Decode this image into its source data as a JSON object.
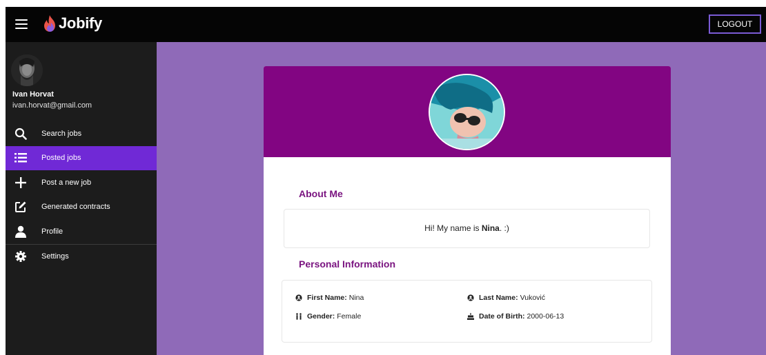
{
  "app": {
    "name": "Jobify"
  },
  "header": {
    "logout_label": "LOGOUT"
  },
  "user": {
    "name": "Ivan Horvat",
    "email": "ivan.horvat@gmail.com"
  },
  "sidebar": {
    "items": [
      {
        "label": "Search jobs",
        "icon": "search-icon"
      },
      {
        "label": "Posted jobs",
        "icon": "list-icon",
        "active": true
      },
      {
        "label": "Post a new job",
        "icon": "plus-icon"
      },
      {
        "label": "Generated contracts",
        "icon": "edit-icon"
      },
      {
        "label": "Profile",
        "icon": "person-icon"
      },
      {
        "label": "Settings",
        "icon": "gear-icon"
      }
    ]
  },
  "profile": {
    "about_title": "About Me",
    "about_prefix": "Hi! My name is ",
    "about_name": "Nina",
    "about_suffix": ". :)",
    "personal_title": "Personal Information",
    "first_name_label": "First Name:",
    "first_name": "Nina",
    "last_name_label": "Last Name:",
    "last_name": "Vuković",
    "gender_label": "Gender:",
    "gender": "Female",
    "dob_label": "Date of Birth:",
    "dob": "2000-06-13"
  },
  "colors": {
    "topbar": "#050505",
    "sidebar": "#1c1c1c",
    "active_item": "#7029d6",
    "content_bg": "#8f6ab8",
    "card_header": "#820582",
    "section_title": "#7a1480",
    "logout_border": "#7b5bd6"
  }
}
